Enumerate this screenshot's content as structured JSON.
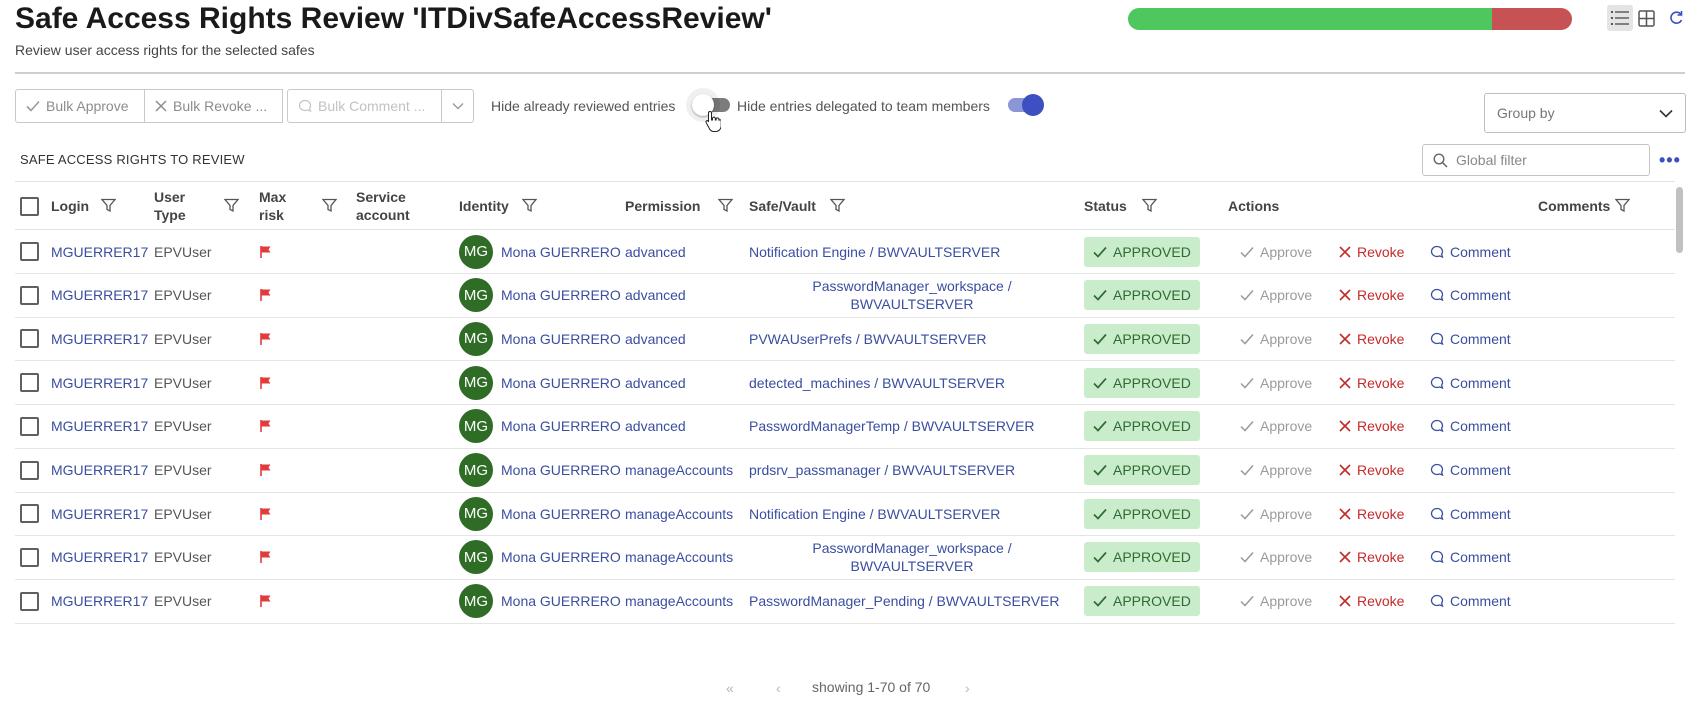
{
  "header": {
    "title": "Safe Access Rights Review 'ITDivSafeAccessReview'",
    "subtitle": "Review user access rights for the selected safes",
    "progress": {
      "approved_fraction": 0.82,
      "approved_color": "#4fc75f",
      "revoked_color": "#c65254"
    }
  },
  "toolbar": {
    "bulk_approve": "Bulk Approve",
    "bulk_revoke": "Bulk Revoke ...",
    "bulk_comment": "Bulk Comment ...",
    "hide_reviewed_label": "Hide already reviewed entries",
    "hide_reviewed_on": false,
    "hide_delegated_label": "Hide entries delegated to team members",
    "hide_delegated_on": true,
    "group_by_placeholder": "Group by"
  },
  "section": {
    "title": "SAFE ACCESS RIGHTS TO REVIEW",
    "global_filter_placeholder": "Global filter"
  },
  "columns": {
    "login": "Login",
    "user_type_1": "User",
    "user_type_2": "Type",
    "max_risk_1": "Max",
    "max_risk_2": "risk",
    "service_1": "Service",
    "service_2": "account",
    "identity": "Identity",
    "permission": "Permission",
    "safe_vault": "Safe/Vault",
    "status": "Status",
    "actions": "Actions",
    "comments": "Comments"
  },
  "action_labels": {
    "approve": "Approve",
    "revoke": "Revoke",
    "comment": "Comment"
  },
  "rows": [
    {
      "login": "MGUERRER17",
      "user_type": "EPVUser",
      "initials": "MG",
      "identity": "Mona GUERRERO",
      "permission": "advanced",
      "vault_a": "Notification Engine / BWVAULTSERVER",
      "vault_b": "",
      "status": "APPROVED"
    },
    {
      "login": "MGUERRER17",
      "user_type": "EPVUser",
      "initials": "MG",
      "identity": "Mona GUERRERO",
      "permission": "advanced",
      "vault_a": "PasswordManager_workspace /",
      "vault_b": "BWVAULTSERVER",
      "status": "APPROVED"
    },
    {
      "login": "MGUERRER17",
      "user_type": "EPVUser",
      "initials": "MG",
      "identity": "Mona GUERRERO",
      "permission": "advanced",
      "vault_a": "PVWAUserPrefs / BWVAULTSERVER",
      "vault_b": "",
      "status": "APPROVED"
    },
    {
      "login": "MGUERRER17",
      "user_type": "EPVUser",
      "initials": "MG",
      "identity": "Mona GUERRERO",
      "permission": "advanced",
      "vault_a": "detected_machines / BWVAULTSERVER",
      "vault_b": "",
      "status": "APPROVED"
    },
    {
      "login": "MGUERRER17",
      "user_type": "EPVUser",
      "initials": "MG",
      "identity": "Mona GUERRERO",
      "permission": "advanced",
      "vault_a": "PasswordManagerTemp / BWVAULTSERVER",
      "vault_b": "",
      "status": "APPROVED"
    },
    {
      "login": "MGUERRER17",
      "user_type": "EPVUser",
      "initials": "MG",
      "identity": "Mona GUERRERO",
      "permission": "manageAccounts",
      "vault_a": "prdsrv_passmanager / BWVAULTSERVER",
      "vault_b": "",
      "status": "APPROVED"
    },
    {
      "login": "MGUERRER17",
      "user_type": "EPVUser",
      "initials": "MG",
      "identity": "Mona GUERRERO",
      "permission": "manageAccounts",
      "vault_a": "Notification Engine / BWVAULTSERVER",
      "vault_b": "",
      "status": "APPROVED"
    },
    {
      "login": "MGUERRER17",
      "user_type": "EPVUser",
      "initials": "MG",
      "identity": "Mona GUERRERO",
      "permission": "manageAccounts",
      "vault_a": "PasswordManager_workspace /",
      "vault_b": "BWVAULTSERVER",
      "status": "APPROVED"
    },
    {
      "login": "MGUERRER17",
      "user_type": "EPVUser",
      "initials": "MG",
      "identity": "Mona GUERRERO",
      "permission": "manageAccounts",
      "vault_a": "PasswordManager_Pending / BWVAULTSERVER",
      "vault_b": "",
      "status": "APPROVED"
    }
  ],
  "pagination": {
    "text": "showing 1-70 of 70",
    "first": "«",
    "prev": "‹",
    "next": "›"
  },
  "icons": {
    "check": "check-icon",
    "close": "close-icon",
    "comment": "comment-icon",
    "filter": "filter-icon",
    "flag": "flag-icon",
    "search": "search-icon",
    "list_view": "list-view-icon",
    "grid_view": "grid-view-icon",
    "refresh": "refresh-icon"
  }
}
